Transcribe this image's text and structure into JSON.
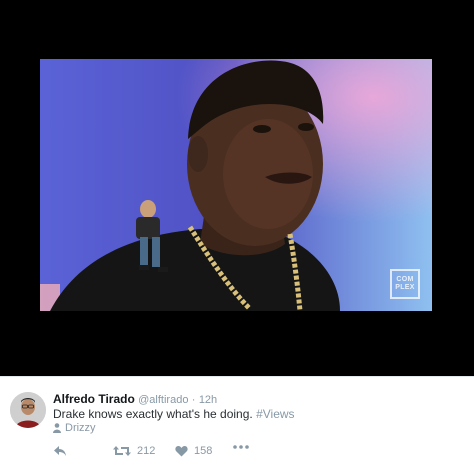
{
  "media": {
    "watermark": {
      "line1": "COM",
      "line2": "PLEX"
    }
  },
  "tweet": {
    "display_name": "Alfredo Tirado",
    "handle": "@alftirado",
    "separator": "·",
    "time": "12h",
    "text": "Drake knows exactly what's he doing.",
    "hashtag": "#Views",
    "location": "Drizzy",
    "actions": {
      "reply_icon": "reply-icon",
      "retweet_icon": "retweet-icon",
      "retweet_count": "212",
      "like_icon": "heart-icon",
      "like_count": "158",
      "more_icon": "more-icon"
    }
  },
  "colors": {
    "background": "#000000",
    "card": "#ffffff",
    "muted": "#8899a6",
    "text": "#292f33"
  }
}
